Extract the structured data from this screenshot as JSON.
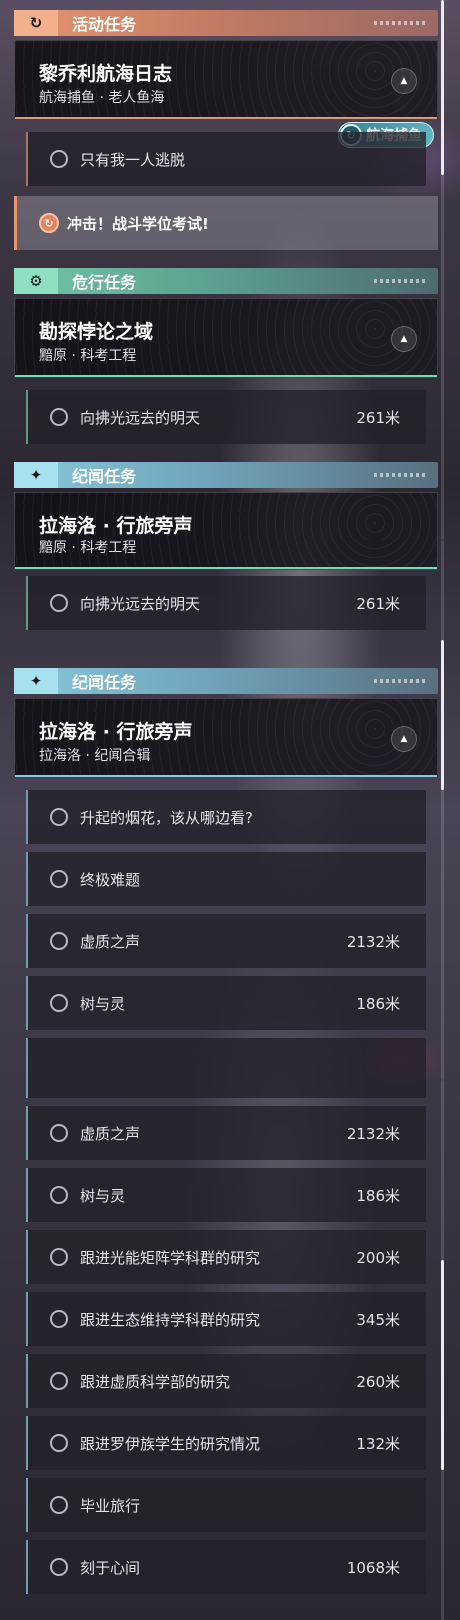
{
  "sections": {
    "event": {
      "icon": "event-quest-icon",
      "title": "活动任务"
    },
    "danger": {
      "icon": "danger-quest-icon",
      "title": "危行任务"
    },
    "story": {
      "icon": "story-quest-icon",
      "title": "纪闻任务"
    }
  },
  "event_card": {
    "title": "黎乔利航海日志",
    "subtitle": "航海捕鱼 · 老人鱼海"
  },
  "event_badge": {
    "label": "航海捕鱼"
  },
  "event_objective": {
    "label": "只有我一人逃脱"
  },
  "tracked": {
    "label": "冲击！战斗学位考试!"
  },
  "danger_card": {
    "title": "勘探悖论之域",
    "subtitle": "黯原 · 科考工程"
  },
  "danger_objective": {
    "label": "向拂光远去的明天",
    "distance": "261米"
  },
  "story_card": {
    "title": "拉海洛 · 行旅旁声",
    "subtitle": "拉海洛 · 纪闻合辑",
    "partial_title": "拉海洛 · 行旅旁声"
  },
  "story_objectives": [
    {
      "label": "升起的烟花，该从哪边看?",
      "distance": ""
    },
    {
      "label": "终极难题",
      "distance": ""
    },
    {
      "label": "虚质之声",
      "distance": "2132米"
    },
    {
      "label": "树与灵",
      "distance": "186米"
    },
    {
      "label": "跟进光能矩阵学科群的研究",
      "distance": "200米"
    },
    {
      "label": "跟进生态维持学科群的研究",
      "distance": "345米"
    },
    {
      "label": "跟进虚质科学部的研究",
      "distance": "260米"
    },
    {
      "label": "跟进罗伊族学生的研究情况",
      "distance": "132米"
    },
    {
      "label": "毕业旅行",
      "distance": ""
    },
    {
      "label": "刻于心间",
      "distance": "1068米"
    }
  ],
  "colors": {
    "event": "#e7946f",
    "danger": "#6fc6a5",
    "story": "#86c8dd"
  }
}
